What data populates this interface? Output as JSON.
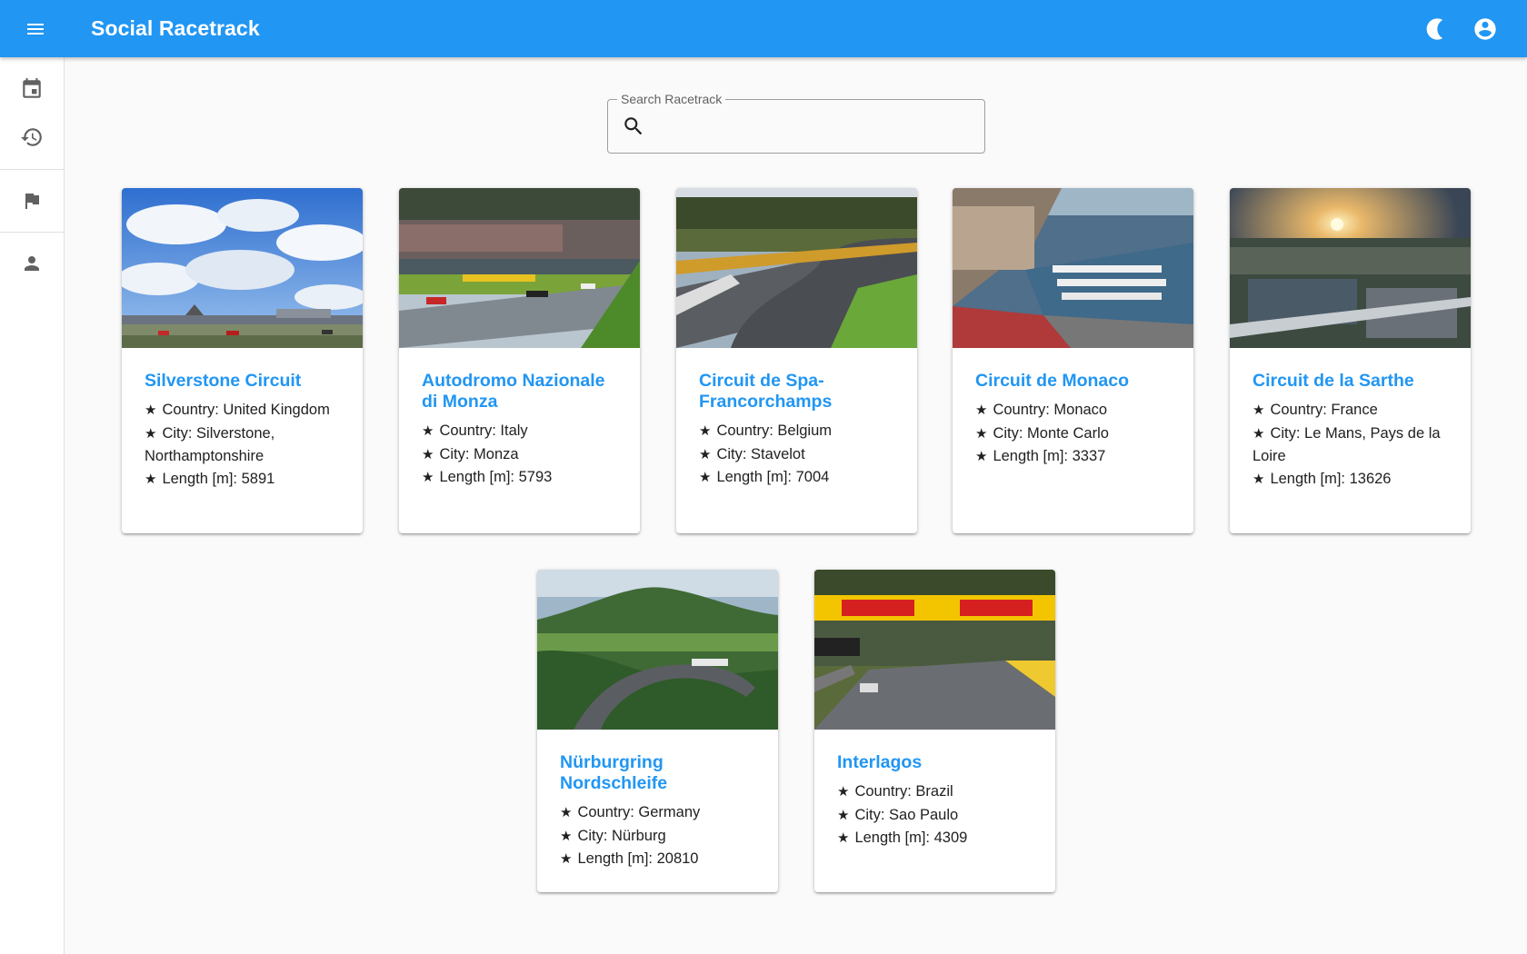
{
  "app": {
    "title": "Social Racetrack"
  },
  "appbar_icons": [
    "menu-icon",
    "moon-icon",
    "account-circle-icon"
  ],
  "rail": {
    "items": [
      {
        "icon": "calendar-icon"
      },
      {
        "icon": "history-icon"
      },
      {
        "icon": "flag-icon"
      },
      {
        "icon": "person-icon"
      }
    ]
  },
  "search": {
    "label": "Search Racetrack",
    "value": "",
    "icon": "search-icon"
  },
  "colors": {
    "primary": "#2196f3",
    "background": "#fafafa"
  },
  "labels": {
    "country": "Country: ",
    "city": "City: ",
    "length": "Length [m]: "
  },
  "tracks": [
    {
      "name": "Silverstone Circuit",
      "country": "United Kingdom",
      "city": "Silverstone, Northamptonshire",
      "length": "5891"
    },
    {
      "name": "Autodromo Nazionale di Monza",
      "country": "Italy",
      "city": "Monza",
      "length": "5793"
    },
    {
      "name": "Circuit de Spa-Francorchamps",
      "country": "Belgium",
      "city": "Stavelot",
      "length": "7004"
    },
    {
      "name": "Circuit de Monaco",
      "country": "Monaco",
      "city": "Monte Carlo",
      "length": "3337"
    },
    {
      "name": "Circuit de la Sarthe",
      "country": "France",
      "city": "Le Mans, Pays de la Loire",
      "length": "13626"
    },
    {
      "name": "Nürburgring Nordschleife",
      "country": "Germany",
      "city": "Nürburg",
      "length": "20810"
    },
    {
      "name": "Interlagos",
      "country": "Brazil",
      "city": "Sao Paulo",
      "length": "4309"
    }
  ]
}
